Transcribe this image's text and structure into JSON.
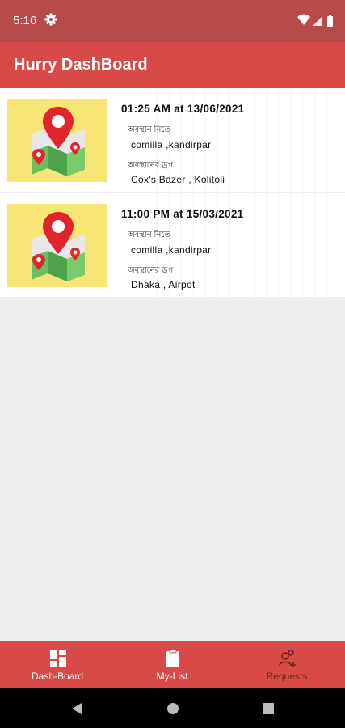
{
  "status_bar": {
    "time": "5:16",
    "icons": [
      "gear-icon",
      "wifi-icon",
      "signal-icon",
      "battery-icon"
    ]
  },
  "app_bar": {
    "title": "Hurry DashBoard"
  },
  "trips": [
    {
      "datetime": "01:25 AM at 13/06/2021",
      "from_label": "অবস্থান নিতে",
      "from": "comilla ,kandirpar",
      "to_label": "অবস্থানের ড্রপ",
      "to": "Cox's Bazer , Kolitoli",
      "icon": "map-location-icon"
    },
    {
      "datetime": "11:00 PM at 15/03/2021",
      "from_label": "অবস্থান নিতে",
      "from": "comilla ,kandirpar",
      "to_label": "অবস্থানের ড্রপ",
      "to": "Dhaka , Airpot",
      "icon": "map-location-icon"
    }
  ],
  "bottom_nav": {
    "items": [
      {
        "label": "Dash-Board",
        "icon": "dashboard-icon",
        "active": true
      },
      {
        "label": "My-List",
        "icon": "clipboard-icon",
        "active": true
      },
      {
        "label": "Requests",
        "icon": "add-users-icon",
        "active": false
      }
    ]
  },
  "system_nav": [
    "back-icon",
    "home-icon",
    "recents-icon"
  ],
  "colors": {
    "primary": "#d84a48",
    "status_bar": "#b64b4a",
    "thumb_bg": "#f7e676",
    "background": "#eeeeee"
  }
}
